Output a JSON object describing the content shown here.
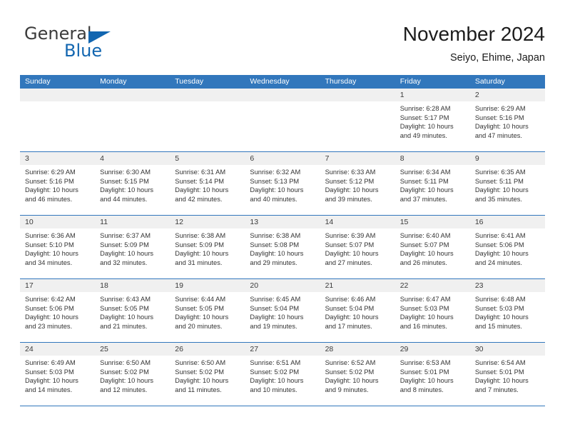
{
  "brand": {
    "word_one": "General",
    "word_two": "Blue",
    "accent_color": "#1266b0"
  },
  "header": {
    "title": "November 2024",
    "subtitle": "Seiyo, Ehime, Japan"
  },
  "calendar": {
    "header_color": "#3277bc",
    "weekdays": [
      "Sunday",
      "Monday",
      "Tuesday",
      "Wednesday",
      "Thursday",
      "Friday",
      "Saturday"
    ],
    "weeks": [
      [
        {
          "day": "",
          "sunrise": "",
          "sunset": "",
          "daylight": "",
          "empty": true
        },
        {
          "day": "",
          "sunrise": "",
          "sunset": "",
          "daylight": "",
          "empty": true
        },
        {
          "day": "",
          "sunrise": "",
          "sunset": "",
          "daylight": "",
          "empty": true
        },
        {
          "day": "",
          "sunrise": "",
          "sunset": "",
          "daylight": "",
          "empty": true
        },
        {
          "day": "",
          "sunrise": "",
          "sunset": "",
          "daylight": "",
          "empty": true
        },
        {
          "day": "1",
          "sunrise": "Sunrise: 6:28 AM",
          "sunset": "Sunset: 5:17 PM",
          "daylight": "Daylight: 10 hours and 49 minutes."
        },
        {
          "day": "2",
          "sunrise": "Sunrise: 6:29 AM",
          "sunset": "Sunset: 5:16 PM",
          "daylight": "Daylight: 10 hours and 47 minutes."
        }
      ],
      [
        {
          "day": "3",
          "sunrise": "Sunrise: 6:29 AM",
          "sunset": "Sunset: 5:16 PM",
          "daylight": "Daylight: 10 hours and 46 minutes."
        },
        {
          "day": "4",
          "sunrise": "Sunrise: 6:30 AM",
          "sunset": "Sunset: 5:15 PM",
          "daylight": "Daylight: 10 hours and 44 minutes."
        },
        {
          "day": "5",
          "sunrise": "Sunrise: 6:31 AM",
          "sunset": "Sunset: 5:14 PM",
          "daylight": "Daylight: 10 hours and 42 minutes."
        },
        {
          "day": "6",
          "sunrise": "Sunrise: 6:32 AM",
          "sunset": "Sunset: 5:13 PM",
          "daylight": "Daylight: 10 hours and 40 minutes."
        },
        {
          "day": "7",
          "sunrise": "Sunrise: 6:33 AM",
          "sunset": "Sunset: 5:12 PM",
          "daylight": "Daylight: 10 hours and 39 minutes."
        },
        {
          "day": "8",
          "sunrise": "Sunrise: 6:34 AM",
          "sunset": "Sunset: 5:11 PM",
          "daylight": "Daylight: 10 hours and 37 minutes."
        },
        {
          "day": "9",
          "sunrise": "Sunrise: 6:35 AM",
          "sunset": "Sunset: 5:11 PM",
          "daylight": "Daylight: 10 hours and 35 minutes."
        }
      ],
      [
        {
          "day": "10",
          "sunrise": "Sunrise: 6:36 AM",
          "sunset": "Sunset: 5:10 PM",
          "daylight": "Daylight: 10 hours and 34 minutes."
        },
        {
          "day": "11",
          "sunrise": "Sunrise: 6:37 AM",
          "sunset": "Sunset: 5:09 PM",
          "daylight": "Daylight: 10 hours and 32 minutes."
        },
        {
          "day": "12",
          "sunrise": "Sunrise: 6:38 AM",
          "sunset": "Sunset: 5:09 PM",
          "daylight": "Daylight: 10 hours and 31 minutes."
        },
        {
          "day": "13",
          "sunrise": "Sunrise: 6:38 AM",
          "sunset": "Sunset: 5:08 PM",
          "daylight": "Daylight: 10 hours and 29 minutes."
        },
        {
          "day": "14",
          "sunrise": "Sunrise: 6:39 AM",
          "sunset": "Sunset: 5:07 PM",
          "daylight": "Daylight: 10 hours and 27 minutes."
        },
        {
          "day": "15",
          "sunrise": "Sunrise: 6:40 AM",
          "sunset": "Sunset: 5:07 PM",
          "daylight": "Daylight: 10 hours and 26 minutes."
        },
        {
          "day": "16",
          "sunrise": "Sunrise: 6:41 AM",
          "sunset": "Sunset: 5:06 PM",
          "daylight": "Daylight: 10 hours and 24 minutes."
        }
      ],
      [
        {
          "day": "17",
          "sunrise": "Sunrise: 6:42 AM",
          "sunset": "Sunset: 5:06 PM",
          "daylight": "Daylight: 10 hours and 23 minutes."
        },
        {
          "day": "18",
          "sunrise": "Sunrise: 6:43 AM",
          "sunset": "Sunset: 5:05 PM",
          "daylight": "Daylight: 10 hours and 21 minutes."
        },
        {
          "day": "19",
          "sunrise": "Sunrise: 6:44 AM",
          "sunset": "Sunset: 5:05 PM",
          "daylight": "Daylight: 10 hours and 20 minutes."
        },
        {
          "day": "20",
          "sunrise": "Sunrise: 6:45 AM",
          "sunset": "Sunset: 5:04 PM",
          "daylight": "Daylight: 10 hours and 19 minutes."
        },
        {
          "day": "21",
          "sunrise": "Sunrise: 6:46 AM",
          "sunset": "Sunset: 5:04 PM",
          "daylight": "Daylight: 10 hours and 17 minutes."
        },
        {
          "day": "22",
          "sunrise": "Sunrise: 6:47 AM",
          "sunset": "Sunset: 5:03 PM",
          "daylight": "Daylight: 10 hours and 16 minutes."
        },
        {
          "day": "23",
          "sunrise": "Sunrise: 6:48 AM",
          "sunset": "Sunset: 5:03 PM",
          "daylight": "Daylight: 10 hours and 15 minutes."
        }
      ],
      [
        {
          "day": "24",
          "sunrise": "Sunrise: 6:49 AM",
          "sunset": "Sunset: 5:03 PM",
          "daylight": "Daylight: 10 hours and 14 minutes."
        },
        {
          "day": "25",
          "sunrise": "Sunrise: 6:50 AM",
          "sunset": "Sunset: 5:02 PM",
          "daylight": "Daylight: 10 hours and 12 minutes."
        },
        {
          "day": "26",
          "sunrise": "Sunrise: 6:50 AM",
          "sunset": "Sunset: 5:02 PM",
          "daylight": "Daylight: 10 hours and 11 minutes."
        },
        {
          "day": "27",
          "sunrise": "Sunrise: 6:51 AM",
          "sunset": "Sunset: 5:02 PM",
          "daylight": "Daylight: 10 hours and 10 minutes."
        },
        {
          "day": "28",
          "sunrise": "Sunrise: 6:52 AM",
          "sunset": "Sunset: 5:02 PM",
          "daylight": "Daylight: 10 hours and 9 minutes."
        },
        {
          "day": "29",
          "sunrise": "Sunrise: 6:53 AM",
          "sunset": "Sunset: 5:01 PM",
          "daylight": "Daylight: 10 hours and 8 minutes."
        },
        {
          "day": "30",
          "sunrise": "Sunrise: 6:54 AM",
          "sunset": "Sunset: 5:01 PM",
          "daylight": "Daylight: 10 hours and 7 minutes."
        }
      ]
    ]
  }
}
